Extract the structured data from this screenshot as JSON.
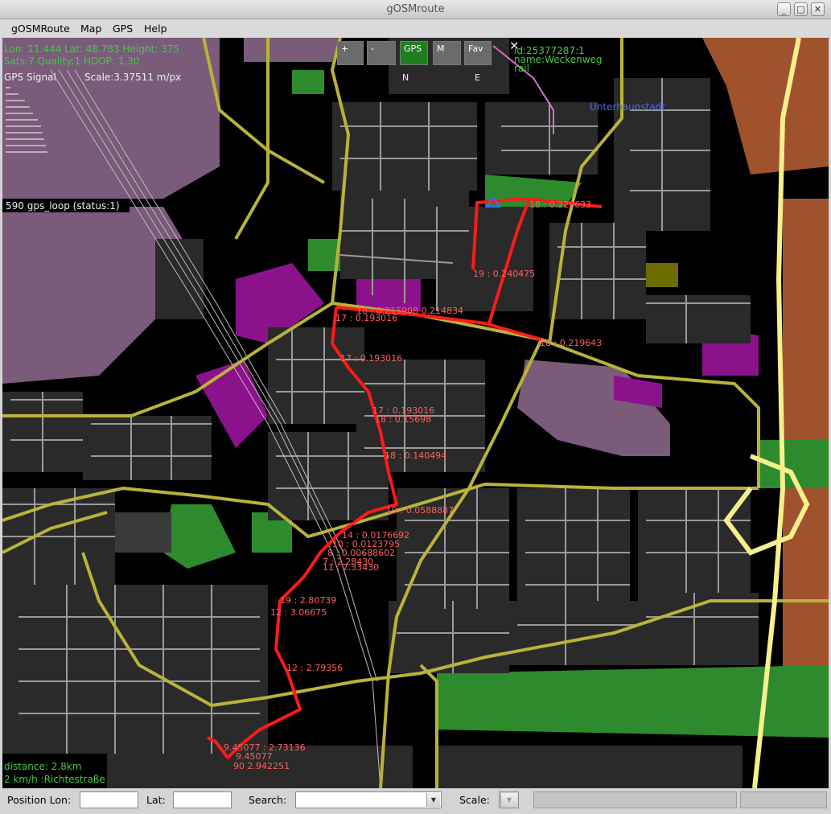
{
  "window": {
    "title": "gOSMroute"
  },
  "menu": [
    "gOSMRoute",
    "Map",
    "GPS",
    "Help"
  ],
  "gps_info": {
    "line1": "Lon: 11.444 Lat: 48.783 Height: 375",
    "line2": "Sats:7 Quality:1 HDOP: 1.30",
    "signal_label": "GPS Signal",
    "scale": "Scale:3.37511 m/px"
  },
  "status_line": "590 gps_loop (status:1)",
  "controls": {
    "zoom_in": "+",
    "zoom_out": "-",
    "gps": "GPS",
    "m": "M",
    "fav": "Fav",
    "compass_n": "N",
    "compass_e": "E",
    "close": "✕"
  },
  "way_info": {
    "id": "id:25377287:1",
    "name": "name:Weckenweg",
    "type": "rail"
  },
  "place_label": "Unterhaunstadt",
  "route_labels": [
    "18 : 0.229633",
    "19 : 0.240475",
    "18 : 0.215908 0.214834",
    "17 : 0.193016",
    "18 : 0.219643",
    "17 : 0.193016",
    "17 : 0.193016",
    "18 : 0.15698",
    "18 : 0.140494",
    "19 : 0.0588887",
    "14 : 0.0176692",
    "10 : 0.0123795",
    "8 : 0.00688602",
    "7 : 2.28430",
    "11 : 2.33430",
    "19 : 2.80739",
    "12 : 3.06675",
    "12 : 2.79356",
    "9.45077 : 2.73136",
    "9.45077",
    "90 2.942251"
  ],
  "nav_info": {
    "distance": "distance: 2.8km",
    "street": "2 km/h :Richtestraße"
  },
  "statusbar": {
    "lon_label": "Position Lon:",
    "lon_value": "",
    "lat_label": "Lat:",
    "lat_value": "",
    "search_label": "Search:",
    "search_value": "",
    "scale_label": "Scale:",
    "scale_value": ""
  },
  "colors": {
    "route": "#ff1a1a",
    "major_road": "#b9b33a",
    "motorway": "#f6f08c",
    "residential": "#2a2a2a",
    "park": "#2d8a2d",
    "industrial": "#7a5b7a",
    "commercial": "#8c128c",
    "farmland": "#a0522d"
  }
}
